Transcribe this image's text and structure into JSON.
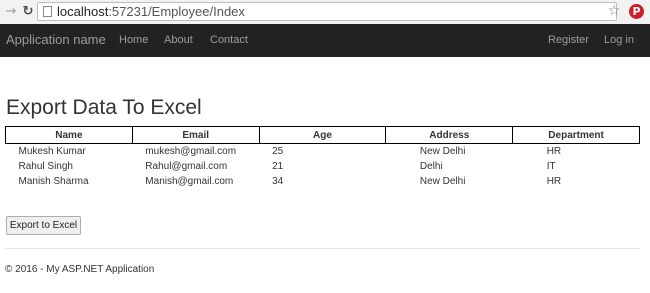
{
  "browser": {
    "url_host": "localhost",
    "url_path": ":57231/Employee/Index",
    "icons": [
      "back-arrow-icon",
      "reload-icon",
      "page-icon",
      "star-icon",
      "pinterest-icon"
    ]
  },
  "navbar": {
    "brand": "Application name",
    "links": [
      "Home",
      "About",
      "Contact"
    ],
    "right_links": [
      "Register",
      "Log in"
    ]
  },
  "main": {
    "title": "Export Data To Excel",
    "table": {
      "headers": [
        "Name",
        "Email",
        "Age",
        "Address",
        "Department"
      ],
      "rows": [
        [
          "Mukesh Kumar",
          "mukesh@gmail.com",
          "25",
          "New Delhi",
          "HR"
        ],
        [
          "Rahul Singh",
          "Rahul@gmail.com",
          "21",
          "Delhi",
          "IT"
        ],
        [
          "Manish Sharma",
          "Manish@gmail.com",
          "34",
          "New Delhi",
          "HR"
        ]
      ]
    },
    "export_button": "Export to Excel"
  },
  "footer": {
    "text": "© 2016 - My ASP.NET Application"
  },
  "colors": {
    "navbar_bg": "#222222",
    "navbar_text": "#9d9d9d",
    "pinterest": "#cb2027"
  }
}
